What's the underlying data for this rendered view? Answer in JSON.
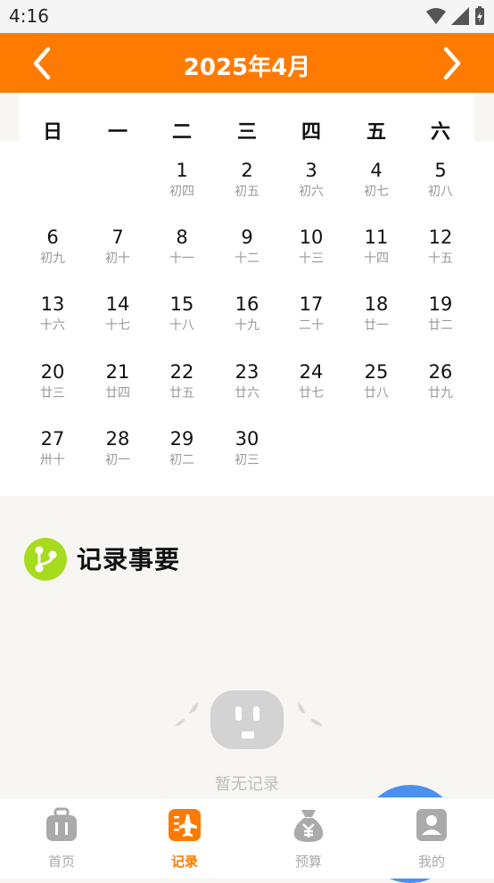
{
  "status": {
    "time": "4:16"
  },
  "header": {
    "title": "2025年4月",
    "prev_icon": "chevron-left-icon",
    "next_icon": "chevron-right-icon"
  },
  "weekdays": [
    "日",
    "一",
    "二",
    "三",
    "四",
    "五",
    "六"
  ],
  "days": [
    {
      "num": "1",
      "lunar": "初四"
    },
    {
      "num": "2",
      "lunar": "初五"
    },
    {
      "num": "3",
      "lunar": "初六"
    },
    {
      "num": "4",
      "lunar": "初七"
    },
    {
      "num": "5",
      "lunar": "初八"
    },
    {
      "num": "6",
      "lunar": "初九"
    },
    {
      "num": "7",
      "lunar": "初十"
    },
    {
      "num": "8",
      "lunar": "十一"
    },
    {
      "num": "9",
      "lunar": "十二"
    },
    {
      "num": "10",
      "lunar": "十三"
    },
    {
      "num": "11",
      "lunar": "十四"
    },
    {
      "num": "12",
      "lunar": "十五"
    },
    {
      "num": "13",
      "lunar": "十六"
    },
    {
      "num": "14",
      "lunar": "十七"
    },
    {
      "num": "15",
      "lunar": "十八"
    },
    {
      "num": "16",
      "lunar": "十九"
    },
    {
      "num": "17",
      "lunar": "二十"
    },
    {
      "num": "18",
      "lunar": "廿一"
    },
    {
      "num": "19",
      "lunar": "廿二"
    },
    {
      "num": "20",
      "lunar": "廿三"
    },
    {
      "num": "21",
      "lunar": "廿四"
    },
    {
      "num": "22",
      "lunar": "廿五"
    },
    {
      "num": "23",
      "lunar": "廿六"
    },
    {
      "num": "24",
      "lunar": "廿七"
    },
    {
      "num": "25",
      "lunar": "廿八"
    },
    {
      "num": "26",
      "lunar": "廿九"
    },
    {
      "num": "27",
      "lunar": "卅十"
    },
    {
      "num": "28",
      "lunar": "初一"
    },
    {
      "num": "29",
      "lunar": "初二"
    },
    {
      "num": "30",
      "lunar": "初三"
    }
  ],
  "section": {
    "title": "记录事要",
    "empty_text": "暂无记录"
  },
  "tabs": [
    {
      "label": "首页",
      "icon": "luggage-icon"
    },
    {
      "label": "记录",
      "icon": "flight-record-icon"
    },
    {
      "label": "预算",
      "icon": "money-bag-icon"
    },
    {
      "label": "我的",
      "icon": "profile-icon"
    }
  ],
  "colors": {
    "accent": "#ff7a00",
    "section_icon": "#a6db1e",
    "fab": "#4a90f0"
  }
}
